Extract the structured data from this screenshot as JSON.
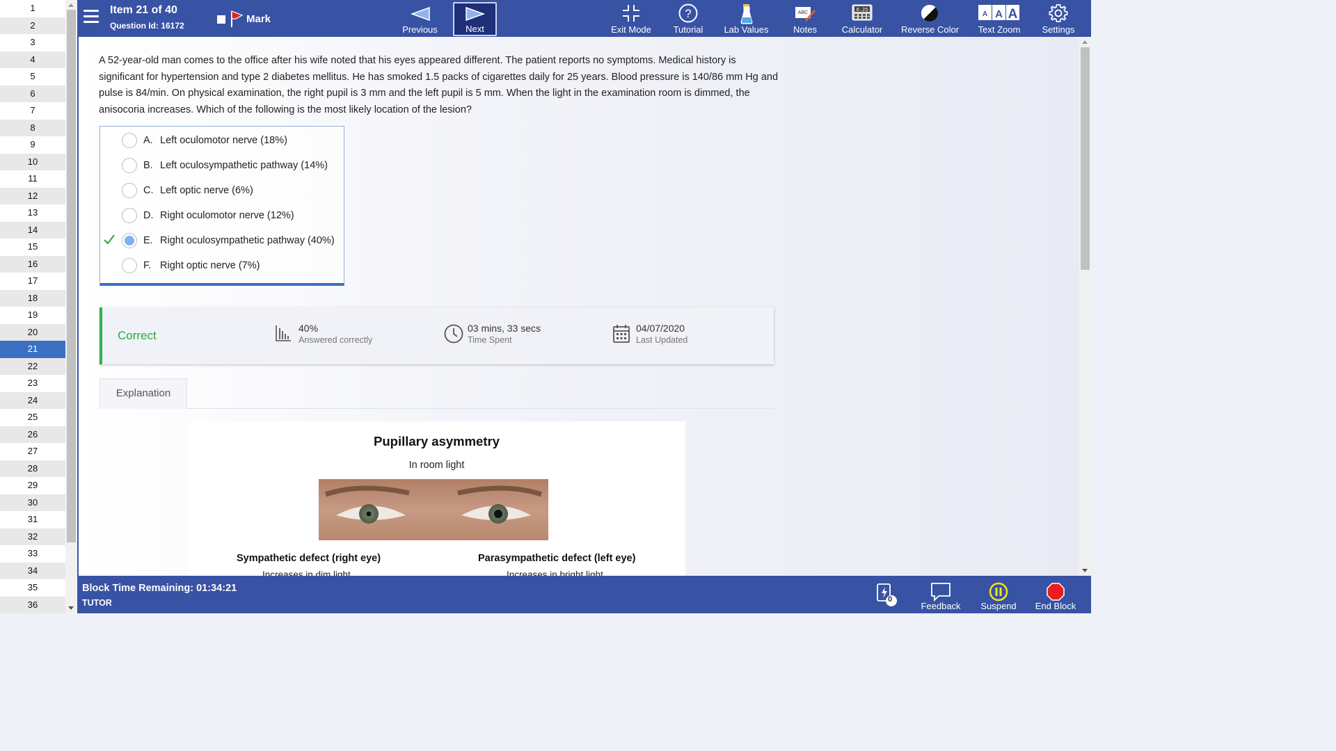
{
  "sidebar": {
    "items": [
      "1",
      "2",
      "3",
      "4",
      "5",
      "6",
      "7",
      "8",
      "9",
      "10",
      "11",
      "12",
      "13",
      "14",
      "15",
      "16",
      "17",
      "18",
      "19",
      "20",
      "21",
      "22",
      "23",
      "24",
      "25",
      "26",
      "27",
      "28",
      "29",
      "30",
      "31",
      "32",
      "33",
      "34",
      "35",
      "36"
    ],
    "current": "21"
  },
  "header": {
    "item_title": "Item 21 of 40",
    "question_id": "Question Id: 16172",
    "mark_label": "Mark",
    "previous_label": "Previous",
    "next_label": "Next",
    "exit_mode_label": "Exit Mode",
    "tutorial_label": "Tutorial",
    "lab_values_label": "Lab Values",
    "notes_label": "Notes",
    "calculator_label": "Calculator",
    "reverse_color_label": "Reverse Color",
    "text_zoom_label": "Text Zoom",
    "settings_label": "Settings"
  },
  "question": {
    "stem": "A 52-year-old man comes to the office after his wife noted that his eyes appeared different.  The patient reports no symptoms.  Medical history is significant for hypertension and type 2 diabetes mellitus.  He has smoked 1.5 packs of cigarettes daily for 25 years.  Blood pressure is 140/86 mm Hg and pulse is 84/min.  On physical examination, the right pupil is 3 mm and the left pupil is 5 mm.  When the light in the examination room is dimmed, the anisocoria increases.  Which of the following is the most likely location of the lesion?",
    "options": [
      {
        "letter": "A.",
        "text": "Left oculomotor nerve (18%)",
        "selected": false,
        "correct": false
      },
      {
        "letter": "B.",
        "text": "Left oculosympathetic pathway (14%)",
        "selected": false,
        "correct": false
      },
      {
        "letter": "C.",
        "text": "Left optic nerve (6%)",
        "selected": false,
        "correct": false
      },
      {
        "letter": "D.",
        "text": "Right oculomotor nerve (12%)",
        "selected": false,
        "correct": false
      },
      {
        "letter": "E.",
        "text": "Right oculosympathetic pathway (40%)",
        "selected": true,
        "correct": true
      },
      {
        "letter": "F.",
        "text": "Right optic nerve (7%)",
        "selected": false,
        "correct": false
      }
    ]
  },
  "result": {
    "status": "Correct",
    "percent": "40%",
    "percent_label": "Answered correctly",
    "time": "03 mins, 33 secs",
    "time_label": "Time Spent",
    "date": "04/07/2020",
    "date_label": "Last Updated"
  },
  "explanation": {
    "tab_label": "Explanation",
    "figure_title": "Pupillary asymmetry",
    "figure_subtitle": "In room light",
    "left_heading": "Sympathetic defect (right eye)",
    "left_sub": "Increases in dim light",
    "right_heading": "Parasympathetic defect (left eye)",
    "right_sub": "Increases in bright light"
  },
  "footer": {
    "time_remaining": "Block Time Remaining: 01:34:21",
    "mode": "TUTOR",
    "flash_count": "0",
    "feedback_label": "Feedback",
    "suspend_label": "Suspend",
    "end_block_label": "End Block"
  },
  "colors": {
    "toolbar": "#3852a4",
    "current_item": "#3b6fc2",
    "correct_green": "#2aa63d",
    "suspend_yellow": "#f5e614",
    "end_red": "#e81e1e"
  }
}
